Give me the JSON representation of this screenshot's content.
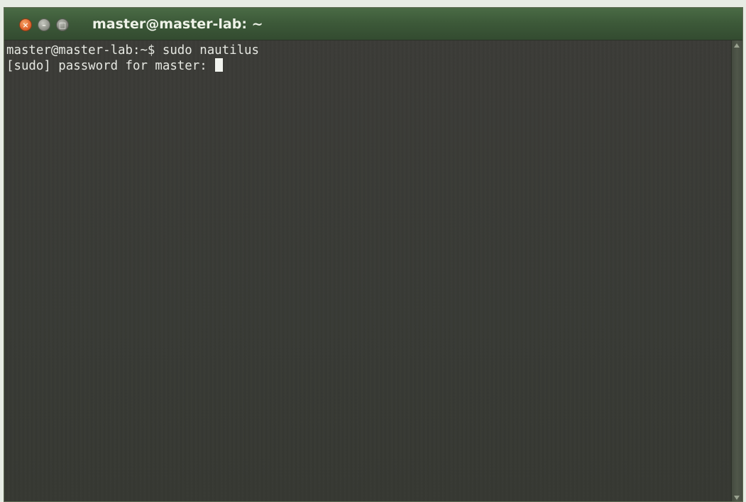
{
  "window": {
    "title": "master@master-lab: ~",
    "controls": {
      "close_glyph": "×",
      "minimize_glyph": "–",
      "maximize_glyph": "□"
    }
  },
  "terminal": {
    "lines": [
      "master@master-lab:~$ sudo nautilus",
      "[sudo] password for master: "
    ]
  },
  "colors": {
    "titlebar": "#3d5a39",
    "terminal_bg": "#3a3a36",
    "terminal_fg": "#e6e8e2",
    "close_button": "#e0652d"
  },
  "icons": [
    "close-icon",
    "minimize-icon",
    "maximize-icon"
  ]
}
